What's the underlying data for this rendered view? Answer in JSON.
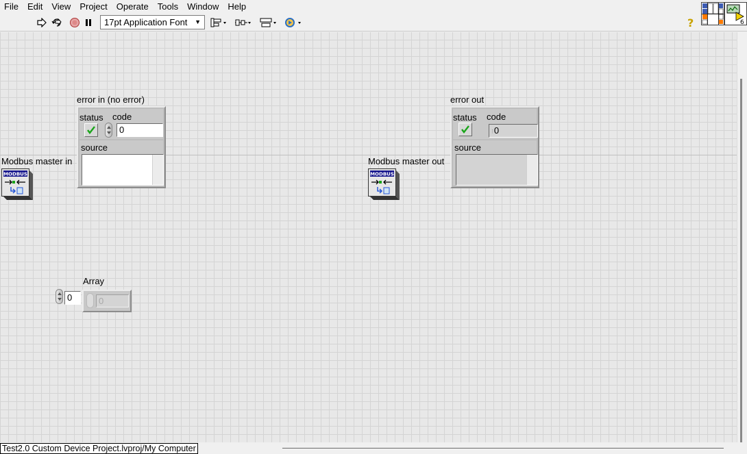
{
  "menu": [
    "File",
    "Edit",
    "View",
    "Project",
    "Operate",
    "Tools",
    "Window",
    "Help"
  ],
  "toolbar": {
    "font_select": "17pt Application Font",
    "buttons": [
      "run-arrow-icon",
      "run-continuously-icon",
      "abort-icon",
      "pause-icon",
      "align-objects-icon",
      "distribute-objects-icon",
      "resize-objects-icon",
      "reorder-icon",
      "help-icon"
    ],
    "vi_icon_number": "6"
  },
  "panel": {
    "error_in": {
      "label": "error in (no error)",
      "status_label": "status",
      "code_label": "code",
      "code_value": "0",
      "source_label": "source",
      "source_value": ""
    },
    "error_out": {
      "label": "error out",
      "status_label": "status",
      "code_label": "code",
      "code_value": "0",
      "source_label": "source",
      "source_value": ""
    },
    "modbus_in": {
      "label": "Modbus master in",
      "icon_text": "MODBUS"
    },
    "modbus_out": {
      "label": "Modbus master out",
      "icon_text": "MODBUS"
    },
    "array": {
      "label": "Array",
      "index_value": "0",
      "element_value": "0"
    }
  },
  "status_bar": {
    "project_path": "Test2.0 Custom Device Project.lvproj/My Computer"
  },
  "colors": {
    "panel_bg": "#e8e8e8",
    "grid": "#d4d4d4",
    "cluster": "#bdbdbd",
    "checkmark": "#1aa51a"
  }
}
